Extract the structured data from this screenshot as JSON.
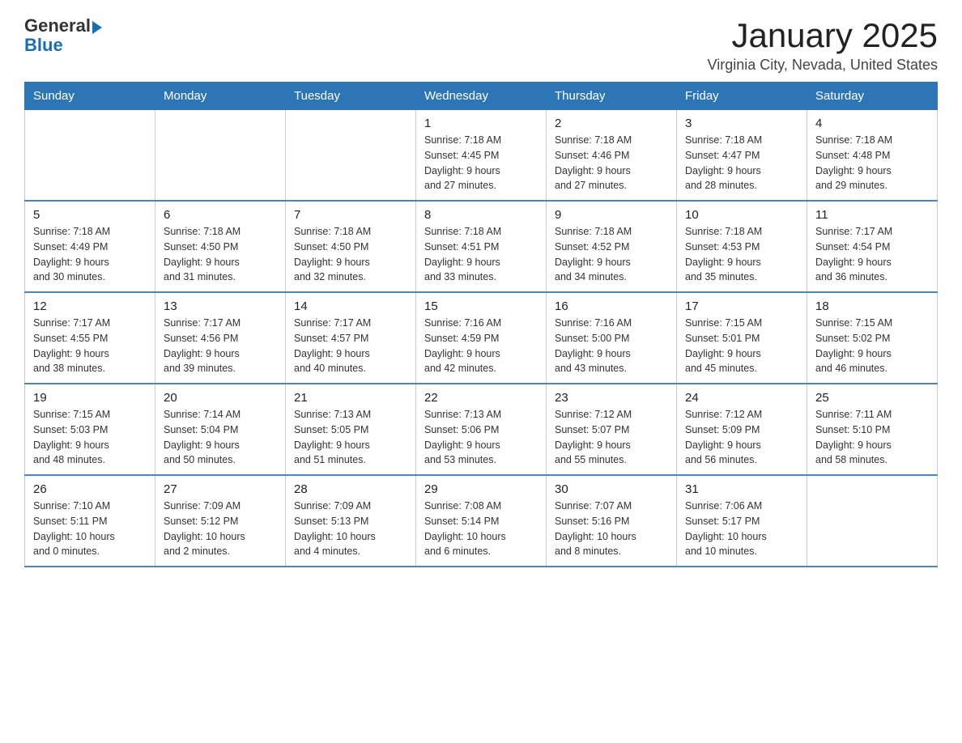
{
  "header": {
    "logo_general": "General",
    "logo_blue": "Blue",
    "month_title": "January 2025",
    "location": "Virginia City, Nevada, United States"
  },
  "days_of_week": [
    "Sunday",
    "Monday",
    "Tuesday",
    "Wednesday",
    "Thursday",
    "Friday",
    "Saturday"
  ],
  "weeks": [
    [
      {
        "day": "",
        "info": ""
      },
      {
        "day": "",
        "info": ""
      },
      {
        "day": "",
        "info": ""
      },
      {
        "day": "1",
        "info": "Sunrise: 7:18 AM\nSunset: 4:45 PM\nDaylight: 9 hours\nand 27 minutes."
      },
      {
        "day": "2",
        "info": "Sunrise: 7:18 AM\nSunset: 4:46 PM\nDaylight: 9 hours\nand 27 minutes."
      },
      {
        "day": "3",
        "info": "Sunrise: 7:18 AM\nSunset: 4:47 PM\nDaylight: 9 hours\nand 28 minutes."
      },
      {
        "day": "4",
        "info": "Sunrise: 7:18 AM\nSunset: 4:48 PM\nDaylight: 9 hours\nand 29 minutes."
      }
    ],
    [
      {
        "day": "5",
        "info": "Sunrise: 7:18 AM\nSunset: 4:49 PM\nDaylight: 9 hours\nand 30 minutes."
      },
      {
        "day": "6",
        "info": "Sunrise: 7:18 AM\nSunset: 4:50 PM\nDaylight: 9 hours\nand 31 minutes."
      },
      {
        "day": "7",
        "info": "Sunrise: 7:18 AM\nSunset: 4:50 PM\nDaylight: 9 hours\nand 32 minutes."
      },
      {
        "day": "8",
        "info": "Sunrise: 7:18 AM\nSunset: 4:51 PM\nDaylight: 9 hours\nand 33 minutes."
      },
      {
        "day": "9",
        "info": "Sunrise: 7:18 AM\nSunset: 4:52 PM\nDaylight: 9 hours\nand 34 minutes."
      },
      {
        "day": "10",
        "info": "Sunrise: 7:18 AM\nSunset: 4:53 PM\nDaylight: 9 hours\nand 35 minutes."
      },
      {
        "day": "11",
        "info": "Sunrise: 7:17 AM\nSunset: 4:54 PM\nDaylight: 9 hours\nand 36 minutes."
      }
    ],
    [
      {
        "day": "12",
        "info": "Sunrise: 7:17 AM\nSunset: 4:55 PM\nDaylight: 9 hours\nand 38 minutes."
      },
      {
        "day": "13",
        "info": "Sunrise: 7:17 AM\nSunset: 4:56 PM\nDaylight: 9 hours\nand 39 minutes."
      },
      {
        "day": "14",
        "info": "Sunrise: 7:17 AM\nSunset: 4:57 PM\nDaylight: 9 hours\nand 40 minutes."
      },
      {
        "day": "15",
        "info": "Sunrise: 7:16 AM\nSunset: 4:59 PM\nDaylight: 9 hours\nand 42 minutes."
      },
      {
        "day": "16",
        "info": "Sunrise: 7:16 AM\nSunset: 5:00 PM\nDaylight: 9 hours\nand 43 minutes."
      },
      {
        "day": "17",
        "info": "Sunrise: 7:15 AM\nSunset: 5:01 PM\nDaylight: 9 hours\nand 45 minutes."
      },
      {
        "day": "18",
        "info": "Sunrise: 7:15 AM\nSunset: 5:02 PM\nDaylight: 9 hours\nand 46 minutes."
      }
    ],
    [
      {
        "day": "19",
        "info": "Sunrise: 7:15 AM\nSunset: 5:03 PM\nDaylight: 9 hours\nand 48 minutes."
      },
      {
        "day": "20",
        "info": "Sunrise: 7:14 AM\nSunset: 5:04 PM\nDaylight: 9 hours\nand 50 minutes."
      },
      {
        "day": "21",
        "info": "Sunrise: 7:13 AM\nSunset: 5:05 PM\nDaylight: 9 hours\nand 51 minutes."
      },
      {
        "day": "22",
        "info": "Sunrise: 7:13 AM\nSunset: 5:06 PM\nDaylight: 9 hours\nand 53 minutes."
      },
      {
        "day": "23",
        "info": "Sunrise: 7:12 AM\nSunset: 5:07 PM\nDaylight: 9 hours\nand 55 minutes."
      },
      {
        "day": "24",
        "info": "Sunrise: 7:12 AM\nSunset: 5:09 PM\nDaylight: 9 hours\nand 56 minutes."
      },
      {
        "day": "25",
        "info": "Sunrise: 7:11 AM\nSunset: 5:10 PM\nDaylight: 9 hours\nand 58 minutes."
      }
    ],
    [
      {
        "day": "26",
        "info": "Sunrise: 7:10 AM\nSunset: 5:11 PM\nDaylight: 10 hours\nand 0 minutes."
      },
      {
        "day": "27",
        "info": "Sunrise: 7:09 AM\nSunset: 5:12 PM\nDaylight: 10 hours\nand 2 minutes."
      },
      {
        "day": "28",
        "info": "Sunrise: 7:09 AM\nSunset: 5:13 PM\nDaylight: 10 hours\nand 4 minutes."
      },
      {
        "day": "29",
        "info": "Sunrise: 7:08 AM\nSunset: 5:14 PM\nDaylight: 10 hours\nand 6 minutes."
      },
      {
        "day": "30",
        "info": "Sunrise: 7:07 AM\nSunset: 5:16 PM\nDaylight: 10 hours\nand 8 minutes."
      },
      {
        "day": "31",
        "info": "Sunrise: 7:06 AM\nSunset: 5:17 PM\nDaylight: 10 hours\nand 10 minutes."
      },
      {
        "day": "",
        "info": ""
      }
    ]
  ]
}
